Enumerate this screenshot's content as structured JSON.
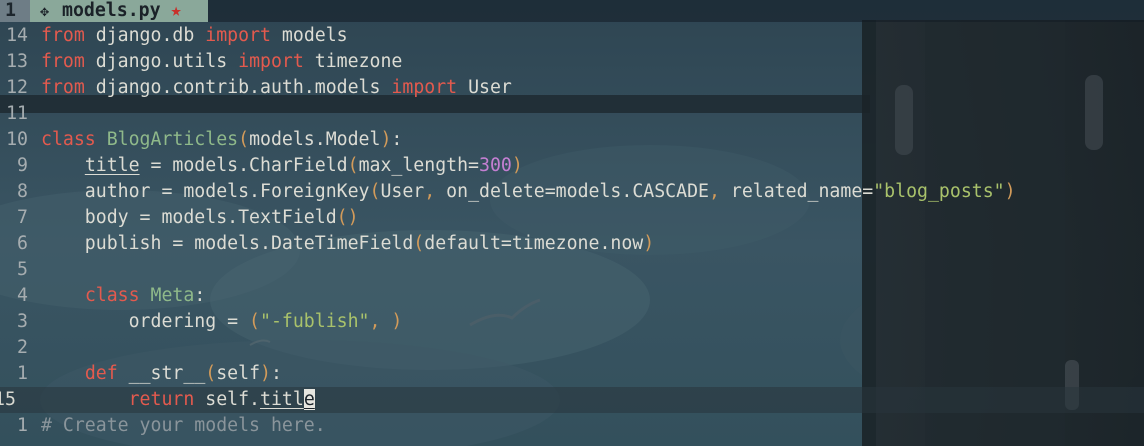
{
  "tabline": {
    "tab_number": "1",
    "icon": "python-icon",
    "filename": "models.py",
    "modified_marker": "★"
  },
  "editor": {
    "lines": [
      {
        "num": "14",
        "tokens": [
          {
            "t": "from",
            "c": "kw"
          },
          {
            "t": " django.db ",
            "c": ""
          },
          {
            "t": "import",
            "c": "kw"
          },
          {
            "t": " models",
            "c": ""
          }
        ]
      },
      {
        "num": "13",
        "tokens": [
          {
            "t": "from",
            "c": "kw"
          },
          {
            "t": " django.utils ",
            "c": ""
          },
          {
            "t": "import",
            "c": "kw"
          },
          {
            "t": " timezone",
            "c": ""
          }
        ]
      },
      {
        "num": "12",
        "tokens": [
          {
            "t": "from",
            "c": "kw"
          },
          {
            "t": " django.contrib.auth.models ",
            "c": ""
          },
          {
            "t": "import",
            "c": "kw"
          },
          {
            "t": " User",
            "c": ""
          }
        ]
      },
      {
        "num": "11",
        "tokens": []
      },
      {
        "num": "10",
        "tokens": [
          {
            "t": "class",
            "c": "kw"
          },
          {
            "t": " ",
            "c": ""
          },
          {
            "t": "BlogArticles",
            "c": "cls"
          },
          {
            "t": "(",
            "c": "par"
          },
          {
            "t": "models.Model",
            "c": ""
          },
          {
            "t": ")",
            "c": "par"
          },
          {
            "t": ":",
            "c": ""
          }
        ]
      },
      {
        "num": "9",
        "tokens": [
          {
            "t": "    ",
            "c": ""
          },
          {
            "t": "title",
            "c": "ul"
          },
          {
            "t": " = models.CharField",
            "c": ""
          },
          {
            "t": "(",
            "c": "par"
          },
          {
            "t": "max_length=",
            "c": ""
          },
          {
            "t": "300",
            "c": "num"
          },
          {
            "t": ")",
            "c": "par"
          }
        ]
      },
      {
        "num": "8",
        "tokens": [
          {
            "t": "    author = models.ForeignKey",
            "c": ""
          },
          {
            "t": "(",
            "c": "par"
          },
          {
            "t": "User",
            "c": ""
          },
          {
            "t": ",",
            "c": "par"
          },
          {
            "t": " on_delete=models.CASCADE",
            "c": ""
          },
          {
            "t": ",",
            "c": "par"
          },
          {
            "t": " related_name=",
            "c": ""
          },
          {
            "t": "\"blog_posts\"",
            "c": "str"
          },
          {
            "t": ")",
            "c": "par"
          }
        ]
      },
      {
        "num": "7",
        "tokens": [
          {
            "t": "    body = models.TextField",
            "c": ""
          },
          {
            "t": "()",
            "c": "par"
          }
        ]
      },
      {
        "num": "6",
        "tokens": [
          {
            "t": "    publish = models.DateTimeField",
            "c": ""
          },
          {
            "t": "(",
            "c": "par"
          },
          {
            "t": "default=timezone.now",
            "c": ""
          },
          {
            "t": ")",
            "c": "par"
          }
        ]
      },
      {
        "num": "5",
        "tokens": []
      },
      {
        "num": "4",
        "tokens": [
          {
            "t": "    ",
            "c": ""
          },
          {
            "t": "class",
            "c": "kw"
          },
          {
            "t": " ",
            "c": ""
          },
          {
            "t": "Meta",
            "c": "cls"
          },
          {
            "t": ":",
            "c": ""
          }
        ]
      },
      {
        "num": "3",
        "tokens": [
          {
            "t": "        ordering = ",
            "c": ""
          },
          {
            "t": "(",
            "c": "par"
          },
          {
            "t": "\"-fublish\"",
            "c": "str"
          },
          {
            "t": ", ",
            "c": "par"
          },
          {
            "t": ")",
            "c": "par"
          }
        ]
      },
      {
        "num": "2",
        "tokens": []
      },
      {
        "num": "1",
        "tokens": [
          {
            "t": "    ",
            "c": ""
          },
          {
            "t": "def",
            "c": "kw"
          },
          {
            "t": " __str__",
            "c": ""
          },
          {
            "t": "(",
            "c": "par"
          },
          {
            "t": "self",
            "c": ""
          },
          {
            "t": ")",
            "c": "par"
          },
          {
            "t": ":",
            "c": ""
          }
        ]
      },
      {
        "num": "15",
        "current": true,
        "tokens": [
          {
            "t": "        ",
            "c": ""
          },
          {
            "t": "return",
            "c": "kw"
          },
          {
            "t": " self.",
            "c": ""
          },
          {
            "t": "titl",
            "c": "ul"
          },
          {
            "t": "e",
            "c": "ul cursor"
          }
        ]
      },
      {
        "num": "1",
        "tokens": [
          {
            "t": "# Create your models here.",
            "c": "comm"
          }
        ]
      }
    ]
  },
  "colors": {
    "keyword": "#e35a4e",
    "class_name": "#8fb98a",
    "number": "#c47fd2",
    "string": "#a9c26b",
    "paren": "#d29b5a",
    "comment": "#8a959b",
    "active_tab": "#8aa89a",
    "modified_marker": "#c8302a"
  }
}
